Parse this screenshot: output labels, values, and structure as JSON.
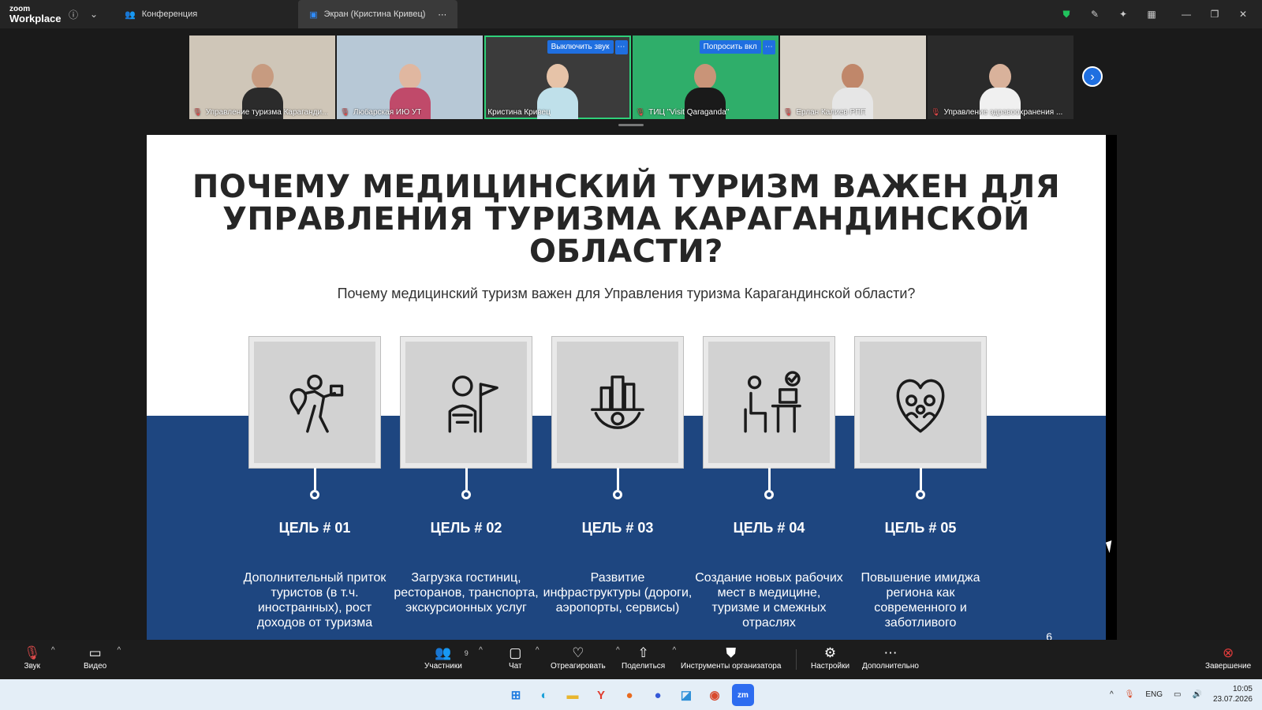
{
  "titlebar": {
    "logo_small": "zoom",
    "logo_big": "Workplace",
    "tabs": [
      {
        "label": "Конференция"
      },
      {
        "label": "Экран (Кристина Кривец)"
      }
    ]
  },
  "participants": [
    {
      "name": "Управление туризма Караганди...",
      "muted": true,
      "bg": "#cfc6b8",
      "skin": "#c79b80",
      "shirt": "#2b2b2b"
    },
    {
      "name": "Любарская ИЮ УТ",
      "muted": true,
      "bg": "#b7c8d6",
      "skin": "#e0b7a0",
      "shirt": "#c04a6a"
    },
    {
      "name": "Кристина Кривец",
      "muted": false,
      "active": true,
      "bg": "#3b3b3b",
      "skin": "#e6c3a8",
      "shirt": "#bfe0ea",
      "pill": "Выключить звук"
    },
    {
      "name": "ТИЦ \"Visit Qaraganda\"",
      "muted": true,
      "bg": "#2fae6a",
      "skin": "#c99478",
      "shirt": "#1a1a1a",
      "pill": "Попросить вкл"
    },
    {
      "name": "Ерлан Калиев РПП",
      "muted": true,
      "bg": "#d8d2c8",
      "skin": "#c0876a",
      "shirt": "#e6e6e6"
    },
    {
      "name": "Управление здравоохранения ...",
      "muted": true,
      "bg": "#2a2a2a",
      "skin": "#d9b29b",
      "shirt": "#f0f0f0"
    }
  ],
  "slide": {
    "title": "ПОЧЕМУ МЕДИЦИНСКИЙ ТУРИЗМ ВАЖЕН ДЛЯ УПРАВЛЕНИЯ ТУРИЗМА КАРАГАНДИНСКОЙ ОБЛАСТИ?",
    "subtitle": "Почему медицинский туризм важен для Управления туризма Карагандинской области?",
    "page": "6",
    "goals": [
      {
        "title": "ЦЕЛЬ # 01",
        "text": "Дополнительный приток туристов (в т.ч. иностранных), рост доходов от туризма",
        "icon": "tourist-icon"
      },
      {
        "title": "ЦЕЛЬ # 02",
        "text": "Загрузка гостиниц, ресторанов, транспорта, экскурсионных услуг",
        "icon": "guide-icon"
      },
      {
        "title": "ЦЕЛЬ # 03",
        "text": "Развитие инфраструктуры (дороги, аэропорты, сервисы)",
        "icon": "city-gear-icon"
      },
      {
        "title": "ЦЕЛЬ # 04",
        "text": "Создание новых рабочих мест в медицине, туризме и смежных отраслях",
        "icon": "workplace-icon"
      },
      {
        "title": "ЦЕЛЬ # 05",
        "text": "Повышение имиджа региона как современного и заботливого",
        "icon": "family-heart-icon"
      }
    ]
  },
  "toolbar": {
    "audio": "Звук",
    "video": "Видео",
    "participants": "Участники",
    "participants_count": "9",
    "chat": "Чат",
    "react": "Отреагировать",
    "share": "Поделиться",
    "host_tools": "Инструменты организатора",
    "settings": "Настройки",
    "more": "Дополнительно",
    "end": "Завершение"
  },
  "taskbar": {
    "lang": "ENG",
    "time": "10:05",
    "date": "23.07.2026"
  }
}
